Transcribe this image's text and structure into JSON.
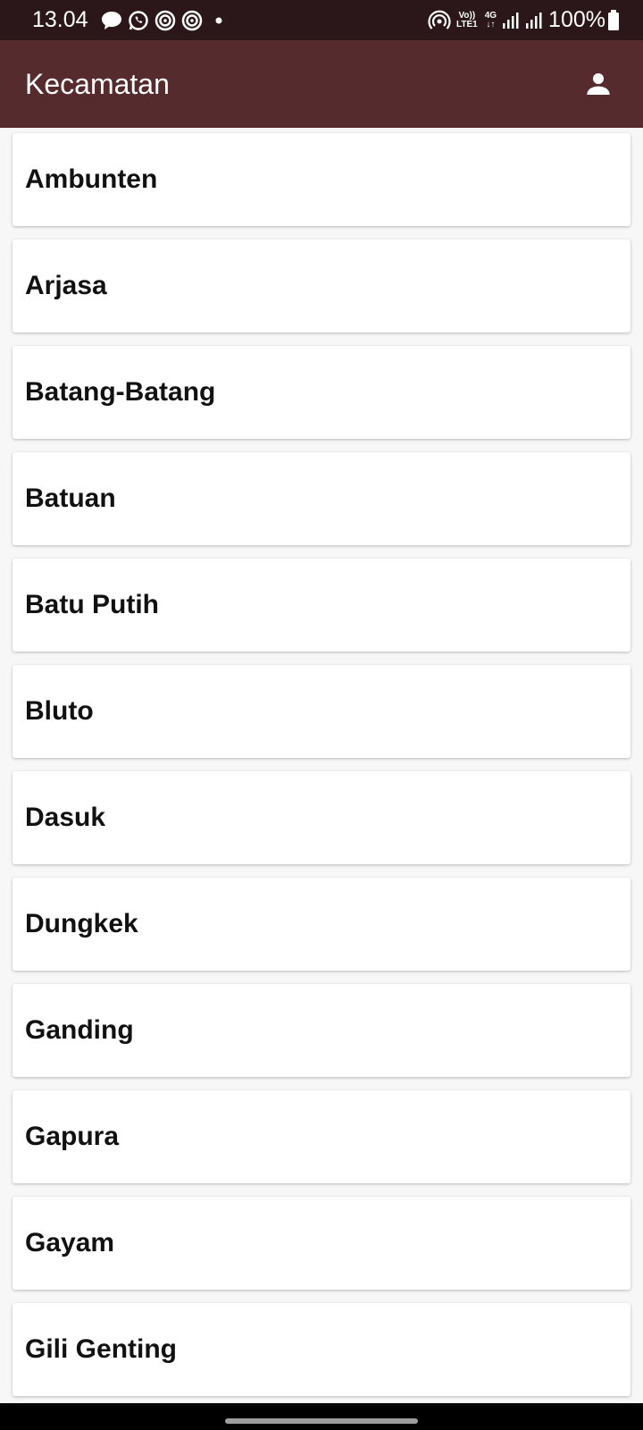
{
  "status_bar": {
    "time": "13.04",
    "network_top": "Vo))",
    "network_bottom": "LTE1",
    "network_type": "4G",
    "battery": "100%",
    "icons": [
      "message-icon",
      "whatsapp-icon",
      "target-icon",
      "target-icon",
      "dot-icon",
      "hotspot-icon",
      "signal-icon",
      "signal-icon",
      "battery-icon"
    ]
  },
  "app_bar": {
    "title": "Kecamatan",
    "account_icon": "account-icon"
  },
  "colors": {
    "status_bar": "#2b1719",
    "app_bar": "#552b2d",
    "background": "#f7f7f7",
    "card": "#ffffff"
  },
  "list": {
    "items": [
      {
        "label": "Ambunten"
      },
      {
        "label": "Arjasa"
      },
      {
        "label": "Batang-Batang"
      },
      {
        "label": "Batuan"
      },
      {
        "label": "Batu Putih"
      },
      {
        "label": "Bluto"
      },
      {
        "label": "Dasuk"
      },
      {
        "label": "Dungkek"
      },
      {
        "label": "Ganding"
      },
      {
        "label": "Gapura"
      },
      {
        "label": "Gayam"
      },
      {
        "label": "Gili Genting"
      }
    ]
  }
}
